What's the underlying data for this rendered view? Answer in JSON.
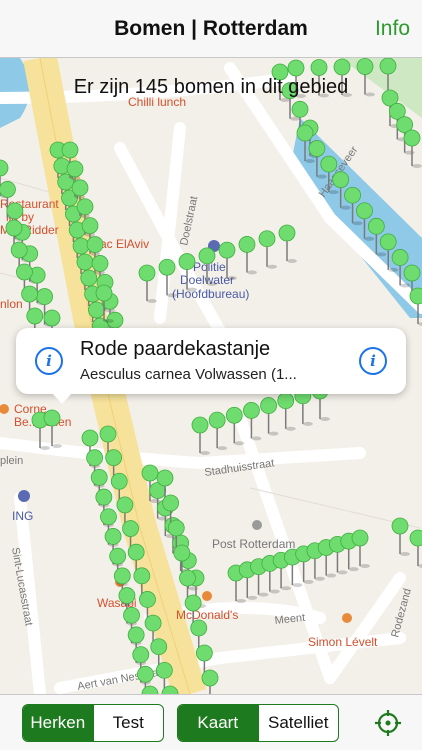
{
  "navbar": {
    "title": "Bomen | Rotterdam",
    "info_label": "Info"
  },
  "map": {
    "tree_count_text": "Er zijn 145 bomen in dit gebied",
    "labels": {
      "chilli_lunch": "Chilli lunch",
      "restaurant": "Restaurant",
      "restaurant2": "lia by",
      "restaurant3": "M... Ridder",
      "elaviv": "ac ElAviv",
      "doelstraat": "Doelstraat",
      "politie1": "Politie",
      "politie2": "Doelwater",
      "politie3": "(Hoofdbureau)",
      "haagseveer": "Haagseveer",
      "rnlon": "nlon",
      "corners1": "Corne",
      "corners2": "Be... tchen",
      "stadhuisplein": "plein",
      "stadhuisstraat": "Stadhuisstraat",
      "ing": "ING",
      "post_rotterdam": "Post Rotterdam",
      "sint_lucasstraat": "Sint-Lucasstraat",
      "wasabi": "Wasabi",
      "mcdonalds": "McDonald's",
      "meent": "Meent",
      "rodezand": "Rodezand",
      "simon_levelt": "Simon Lévelt",
      "aert_van_nesstraat": "Aert van Nesstraat"
    },
    "callout": {
      "title": "Rode paardekastanje",
      "subtitle": "Aesculus carnea Volwassen (1..."
    },
    "colors": {
      "tree": "#6fdc6f",
      "tree_stroke": "#3fae3f",
      "road_yellow": "#f6e29a",
      "water": "#8ec9e8",
      "park": "#cfe8c4"
    }
  },
  "toolbar": {
    "mode_segment": [
      {
        "label": "Herken",
        "active": true
      },
      {
        "label": "Test",
        "active": false
      }
    ],
    "map_type_segment": [
      {
        "label": "Kaart",
        "active": true
      },
      {
        "label": "Satelliet",
        "active": false
      }
    ]
  }
}
